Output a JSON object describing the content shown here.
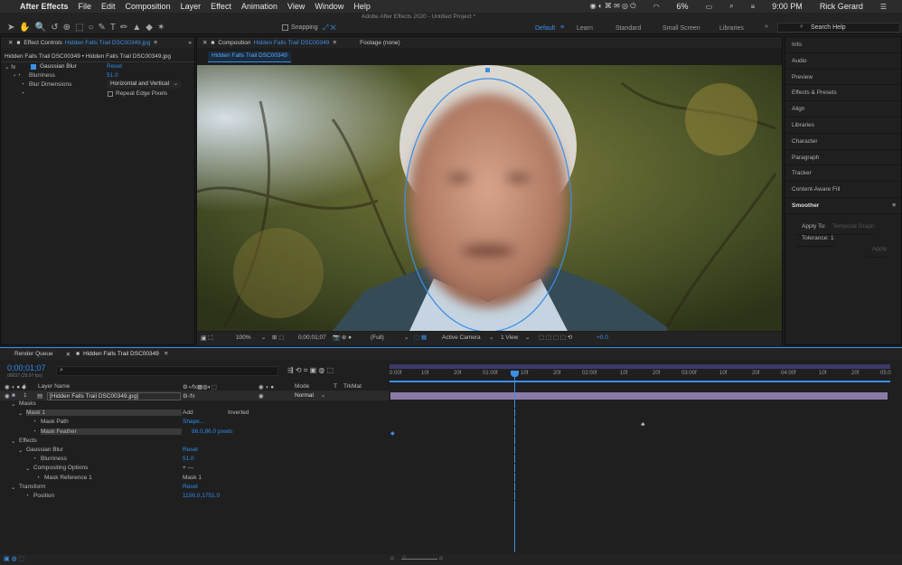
{
  "menubar": {
    "app": "After Effects",
    "items": [
      "File",
      "Edit",
      "Composition",
      "Layer",
      "Effect",
      "Animation",
      "View",
      "Window",
      "Help"
    ],
    "battery": "6%",
    "time": "9:00 PM",
    "user": "Rick Gerard"
  },
  "titlebar": {
    "title": "Adobe After Effects 2020 - Untitled Project *"
  },
  "toolbar": {
    "snapping": "Snapping",
    "workspaces": [
      "Default",
      "Learn",
      "Standard",
      "Small Screen",
      "Libraries"
    ],
    "search_placeholder": "Search Help"
  },
  "effect_controls": {
    "tab": "Effect Controls",
    "tab_file": "Hidden Falls Trail DSC00349.jpg",
    "subtitle": "Hidden Falls Trail DSC00349 • Hidden Falls Trail DSC00349.jpg",
    "effect_name": "Gaussian Blur",
    "reset": "Reset",
    "blurriness_label": "Blurriness",
    "blurriness_value": "51.0",
    "dimensions_label": "Blur Dimensions",
    "dimensions_value": "Horizontal and Vertical",
    "repeat_label": "Repeat Edge Pixels"
  },
  "composition": {
    "tab": "Composition",
    "tab_name": "Hidden Falls Trail DSC00349",
    "footage": "Footage (none)",
    "breadcrumb": "Hidden Falls Trail DSC00349",
    "zoom": "100%",
    "timecode": "0;00;01;07",
    "resolution": "(Full)",
    "camera": "Active Camera",
    "views": "1 View",
    "exposure": "+0.0"
  },
  "right_panels": {
    "items": [
      "Info",
      "Audio",
      "Preview",
      "Effects & Presets",
      "Align",
      "Libraries",
      "Character",
      "Paragraph",
      "Tracker",
      "Content-Aware Fill"
    ],
    "smoother_title": "Smoother",
    "apply_to_label": "Apply To:",
    "apply_to_value": "Temporal Graph",
    "tolerance_label": "Tolerance:",
    "tolerance_value": "1",
    "apply_button": "Apply"
  },
  "timeline": {
    "render_queue": "Render Queue",
    "comp_tab": "Hidden Falls Trail DSC00349",
    "timecode": "0;00;01;07",
    "fps": "00037 (29.97 fps)",
    "search_placeholder": "",
    "col_hash": "#",
    "col_layer": "Layer Name",
    "col_mode": "Mode",
    "col_t": "T",
    "col_trkmat": "TrkMat",
    "layer_num": "1",
    "layer_name": "[Hidden Falls Trail DSC00349.jpg]",
    "layer_mode": "Normal",
    "rows": [
      {
        "label": "Masks",
        "value": ""
      },
      {
        "label": "Mask 1",
        "value": "Add",
        "extra": "Inverted"
      },
      {
        "label": "Mask Path",
        "value": "Shape..."
      },
      {
        "label": "Mask Feather",
        "value": "86.0,86.0 pixels"
      },
      {
        "label": "Effects",
        "value": ""
      },
      {
        "label": "Gaussian Blur",
        "value": "Reset"
      },
      {
        "label": "Blurriness",
        "value": "51.0"
      },
      {
        "label": "Compositing Options",
        "value": "+ —"
      },
      {
        "label": "Mask Reference 1",
        "value": "Mask 1"
      },
      {
        "label": "Transform",
        "value": "Reset"
      },
      {
        "label": "Position",
        "value": "1156.0,1751.0"
      }
    ],
    "ruler": [
      "0:00f",
      "10f",
      "20f",
      "01:00f",
      "10f",
      "20f",
      "02:00f",
      "10f",
      "20f",
      "03:00f",
      "10f",
      "20f",
      "04:00f",
      "10f",
      "20f",
      "05:0"
    ]
  },
  "colors": {
    "accent": "#2d8ceb",
    "layer_bar": "#8c7aa6",
    "work_area": "#3a3a6a"
  }
}
